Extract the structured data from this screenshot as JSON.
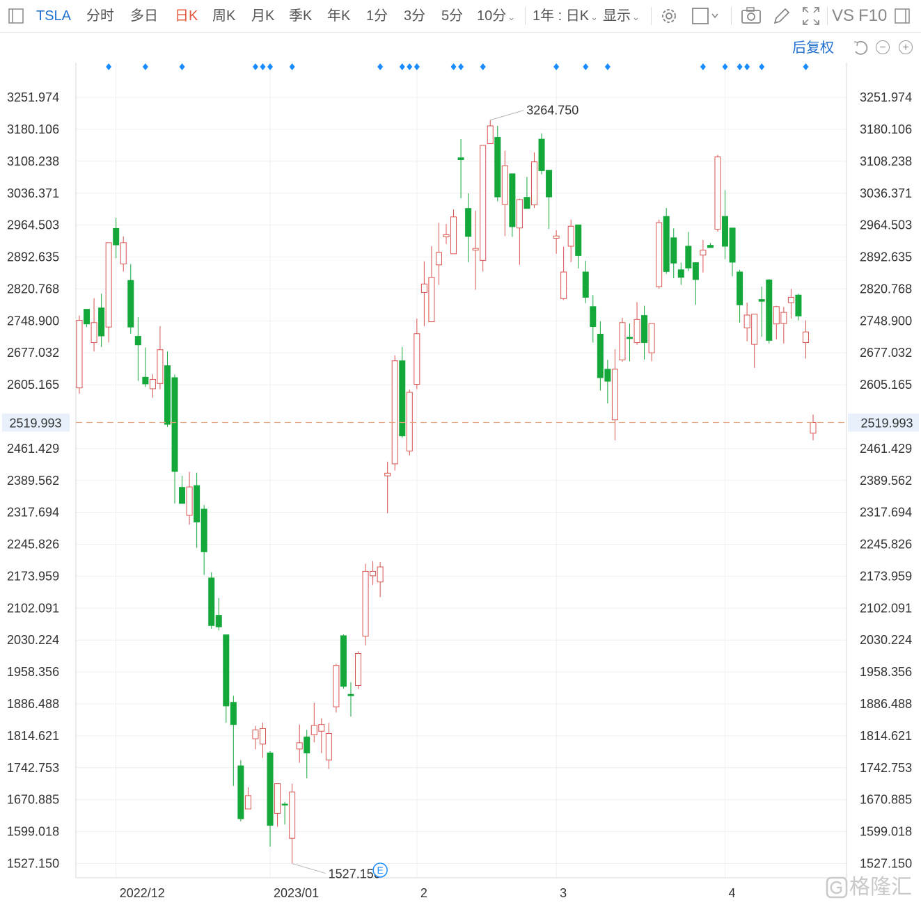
{
  "toolbar": {
    "symbol": "TSLA",
    "periods": [
      "分时",
      "多日",
      "日K",
      "周K",
      "月K",
      "季K",
      "年K",
      "1分",
      "3分",
      "5分",
      "10分"
    ],
    "active_period": "日K",
    "range_select": "1年 : 日K",
    "display_select": "显示",
    "vs_label": "VS",
    "f10_label": "F10"
  },
  "subbar": {
    "adjust_label": "后复权"
  },
  "watermark": "格隆汇",
  "chart_data": {
    "type": "candlestick",
    "y_axis_ticks": [
      "3251.974",
      "3180.106",
      "3108.238",
      "3036.371",
      "2964.503",
      "2892.635",
      "2820.768",
      "2748.900",
      "2677.032",
      "2605.165",
      "2461.429",
      "2389.562",
      "2317.694",
      "2245.826",
      "2173.959",
      "2102.091",
      "2030.224",
      "1958.356",
      "1886.488",
      "1814.621",
      "1742.753",
      "1670.885",
      "1599.018",
      "1527.150"
    ],
    "y_range": [
      1495.0,
      3321.0
    ],
    "x_labels": [
      {
        "label": "2022/12",
        "index": 5
      },
      {
        "label": "2023/01",
        "index": 26
      },
      {
        "label": "2",
        "index": 46
      },
      {
        "label": "3",
        "index": 65
      },
      {
        "label": "4",
        "index": 88
      }
    ],
    "current_price": "2519.993",
    "high_label": "3264.750",
    "low_label": "1527.150",
    "event_marker": "E",
    "event_marker_index": 41,
    "colors": {
      "up": "#d9534f",
      "down": "#14a83b",
      "marker": "#1a8cff",
      "current_line": "#e8a37a",
      "current_text": "#e02020"
    },
    "marker_indices": [
      4,
      9,
      14,
      24,
      25,
      26,
      29,
      41,
      44,
      45,
      46,
      51,
      52,
      55,
      65,
      69,
      72,
      85,
      88,
      90,
      91,
      93,
      99
    ],
    "candles": [
      {
        "o": 2598,
        "h": 2761,
        "l": 2585,
        "c": 2750
      },
      {
        "o": 2775,
        "h": 2775,
        "l": 2735,
        "c": 2742
      },
      {
        "o": 2700,
        "h": 2800,
        "l": 2680,
        "c": 2745
      },
      {
        "o": 2778,
        "h": 2810,
        "l": 2690,
        "c": 2715
      },
      {
        "o": 2735,
        "h": 2925,
        "l": 2700,
        "c": 2925
      },
      {
        "o": 2957,
        "h": 2981,
        "l": 2890,
        "c": 2920
      },
      {
        "o": 2877,
        "h": 2939,
        "l": 2860,
        "c": 2925
      },
      {
        "o": 2840,
        "h": 2877,
        "l": 2720,
        "c": 2735
      },
      {
        "o": 2714,
        "h": 2757,
        "l": 2614,
        "c": 2695
      },
      {
        "o": 2622,
        "h": 2689,
        "l": 2600,
        "c": 2607
      },
      {
        "o": 2596,
        "h": 2629,
        "l": 2576,
        "c": 2617
      },
      {
        "o": 2608,
        "h": 2737,
        "l": 2595,
        "c": 2684
      },
      {
        "o": 2648,
        "h": 2680,
        "l": 2510,
        "c": 2516
      },
      {
        "o": 2621,
        "h": 2628,
        "l": 2338,
        "c": 2410
      },
      {
        "o": 2374,
        "h": 2400,
        "l": 2337,
        "c": 2338
      },
      {
        "o": 2311,
        "h": 2409,
        "l": 2290,
        "c": 2375
      },
      {
        "o": 2378,
        "h": 2407,
        "l": 2238,
        "c": 2296
      },
      {
        "o": 2325,
        "h": 2334,
        "l": 2177,
        "c": 2229
      },
      {
        "o": 2170,
        "h": 2183,
        "l": 2056,
        "c": 2063
      },
      {
        "o": 2086,
        "h": 2125,
        "l": 2052,
        "c": 2060
      },
      {
        "o": 2042,
        "h": 2042,
        "l": 1844,
        "c": 1882
      },
      {
        "o": 1890,
        "h": 1905,
        "l": 1702,
        "c": 1840
      },
      {
        "o": 1747,
        "h": 1760,
        "l": 1622,
        "c": 1628
      },
      {
        "o": 1650,
        "h": 1699,
        "l": 1652,
        "c": 1680
      },
      {
        "o": 1808,
        "h": 1837,
        "l": 1784,
        "c": 1828
      },
      {
        "o": 1796,
        "h": 1844,
        "l": 1765,
        "c": 1831
      },
      {
        "o": 1776,
        "h": 1780,
        "l": 1565,
        "c": 1613
      },
      {
        "o": 1640,
        "h": 1701,
        "l": 1610,
        "c": 1707
      },
      {
        "o": 1661,
        "h": 1666,
        "l": 1615,
        "c": 1659
      },
      {
        "o": 1584,
        "h": 1707,
        "l": 1527,
        "c": 1688
      },
      {
        "o": 1785,
        "h": 1840,
        "l": 1754,
        "c": 1799
      },
      {
        "o": 1812,
        "h": 1828,
        "l": 1719,
        "c": 1776
      },
      {
        "o": 1817,
        "h": 1889,
        "l": 1800,
        "c": 1838
      },
      {
        "o": 1825,
        "h": 1854,
        "l": 1776,
        "c": 1840
      },
      {
        "o": 1760,
        "h": 1844,
        "l": 1740,
        "c": 1820
      },
      {
        "o": 1880,
        "h": 1977,
        "l": 1867,
        "c": 1973
      },
      {
        "o": 2040,
        "h": 2043,
        "l": 1921,
        "c": 1926
      },
      {
        "o": 1908,
        "h": 1935,
        "l": 1858,
        "c": 1905
      },
      {
        "o": 1928,
        "h": 2005,
        "l": 1920,
        "c": 2000
      },
      {
        "o": 2039,
        "h": 2202,
        "l": 2018,
        "c": 2185
      },
      {
        "o": 2175,
        "h": 2208,
        "l": 2154,
        "c": 2185
      },
      {
        "o": 2161,
        "h": 2206,
        "l": 2127,
        "c": 2195
      },
      {
        "o": 2400,
        "h": 2432,
        "l": 2316,
        "c": 2406
      },
      {
        "o": 2427,
        "h": 2671,
        "l": 2412,
        "c": 2659
      },
      {
        "o": 2659,
        "h": 2690,
        "l": 2486,
        "c": 2490
      },
      {
        "o": 2456,
        "h": 2594,
        "l": 2446,
        "c": 2588
      },
      {
        "o": 2606,
        "h": 2754,
        "l": 2595,
        "c": 2720
      },
      {
        "o": 2813,
        "h": 2883,
        "l": 2737,
        "c": 2832
      },
      {
        "o": 2747,
        "h": 2917,
        "l": 2748,
        "c": 2847
      },
      {
        "o": 2875,
        "h": 2970,
        "l": 2830,
        "c": 2903
      },
      {
        "o": 2938,
        "h": 2967,
        "l": 2922,
        "c": 2943
      },
      {
        "o": 2900,
        "h": 3000,
        "l": 2900,
        "c": 2983
      },
      {
        "o": 3116,
        "h": 3158,
        "l": 3025,
        "c": 3112
      },
      {
        "o": 3002,
        "h": 3036,
        "l": 2881,
        "c": 2939
      },
      {
        "o": 2908,
        "h": 2997,
        "l": 2819,
        "c": 2912
      },
      {
        "o": 2885,
        "h": 3143,
        "l": 2860,
        "c": 3144
      },
      {
        "o": 3148,
        "h": 3201,
        "l": 3151,
        "c": 3188
      },
      {
        "o": 3162,
        "h": 3188,
        "l": 3018,
        "c": 3028
      },
      {
        "o": 3011,
        "h": 3132,
        "l": 2940,
        "c": 3098
      },
      {
        "o": 3080,
        "h": 3080,
        "l": 2938,
        "c": 2961
      },
      {
        "o": 2958,
        "h": 3024,
        "l": 2875,
        "c": 3022
      },
      {
        "o": 3027,
        "h": 3073,
        "l": 3003,
        "c": 3002
      },
      {
        "o": 3010,
        "h": 3128,
        "l": 3003,
        "c": 3107
      },
      {
        "o": 3158,
        "h": 3171,
        "l": 3079,
        "c": 3087
      },
      {
        "o": 3088,
        "h": 3088,
        "l": 2956,
        "c": 3028
      },
      {
        "o": 2935,
        "h": 2953,
        "l": 2900,
        "c": 2940
      },
      {
        "o": 2799,
        "h": 2916,
        "l": 2796,
        "c": 2859
      },
      {
        "o": 2917,
        "h": 2977,
        "l": 2881,
        "c": 2962
      },
      {
        "o": 2965,
        "h": 2965,
        "l": 2867,
        "c": 2896
      },
      {
        "o": 2859,
        "h": 2884,
        "l": 2789,
        "c": 2802
      },
      {
        "o": 2781,
        "h": 2807,
        "l": 2700,
        "c": 2736
      },
      {
        "o": 2719,
        "h": 2748,
        "l": 2592,
        "c": 2621
      },
      {
        "o": 2640,
        "h": 2661,
        "l": 2563,
        "c": 2613
      },
      {
        "o": 2526,
        "h": 2685,
        "l": 2480,
        "c": 2640
      },
      {
        "o": 2661,
        "h": 2756,
        "l": 2657,
        "c": 2745
      },
      {
        "o": 2712,
        "h": 2743,
        "l": 2658,
        "c": 2709
      },
      {
        "o": 2700,
        "h": 2791,
        "l": 2695,
        "c": 2752
      },
      {
        "o": 2761,
        "h": 2783,
        "l": 2662,
        "c": 2700
      },
      {
        "o": 2677,
        "h": 2739,
        "l": 2658,
        "c": 2743
      },
      {
        "o": 2826,
        "h": 2977,
        "l": 2821,
        "c": 2970
      },
      {
        "o": 2984,
        "h": 3003,
        "l": 2855,
        "c": 2860
      },
      {
        "o": 2936,
        "h": 2957,
        "l": 2845,
        "c": 2879
      },
      {
        "o": 2864,
        "h": 2880,
        "l": 2830,
        "c": 2847
      },
      {
        "o": 2917,
        "h": 2949,
        "l": 2861,
        "c": 2868
      },
      {
        "o": 2880,
        "h": 2880,
        "l": 2785,
        "c": 2842
      },
      {
        "o": 2897,
        "h": 2931,
        "l": 2858,
        "c": 2908
      },
      {
        "o": 2919,
        "h": 2924,
        "l": 2914,
        "c": 2914
      },
      {
        "o": 2955,
        "h": 3123,
        "l": 2950,
        "c": 3118
      },
      {
        "o": 2984,
        "h": 3043,
        "l": 2888,
        "c": 2917
      },
      {
        "o": 2958,
        "h": 2950,
        "l": 2849,
        "c": 2881
      },
      {
        "o": 2859,
        "h": 2864,
        "l": 2745,
        "c": 2785
      },
      {
        "o": 2733,
        "h": 2790,
        "l": 2703,
        "c": 2762
      },
      {
        "o": 2696,
        "h": 2759,
        "l": 2643,
        "c": 2764
      },
      {
        "o": 2797,
        "h": 2826,
        "l": 2713,
        "c": 2793
      },
      {
        "o": 2841,
        "h": 2843,
        "l": 2698,
        "c": 2705
      },
      {
        "o": 2742,
        "h": 2783,
        "l": 2707,
        "c": 2781
      },
      {
        "o": 2743,
        "h": 2780,
        "l": 2698,
        "c": 2768
      },
      {
        "o": 2790,
        "h": 2821,
        "l": 2754,
        "c": 2802
      },
      {
        "o": 2807,
        "h": 2810,
        "l": 2750,
        "c": 2760
      },
      {
        "o": 2700,
        "h": 2750,
        "l": 2664,
        "c": 2724
      },
      {
        "o": 2496,
        "h": 2538,
        "l": 2480,
        "c": 2520
      }
    ]
  }
}
